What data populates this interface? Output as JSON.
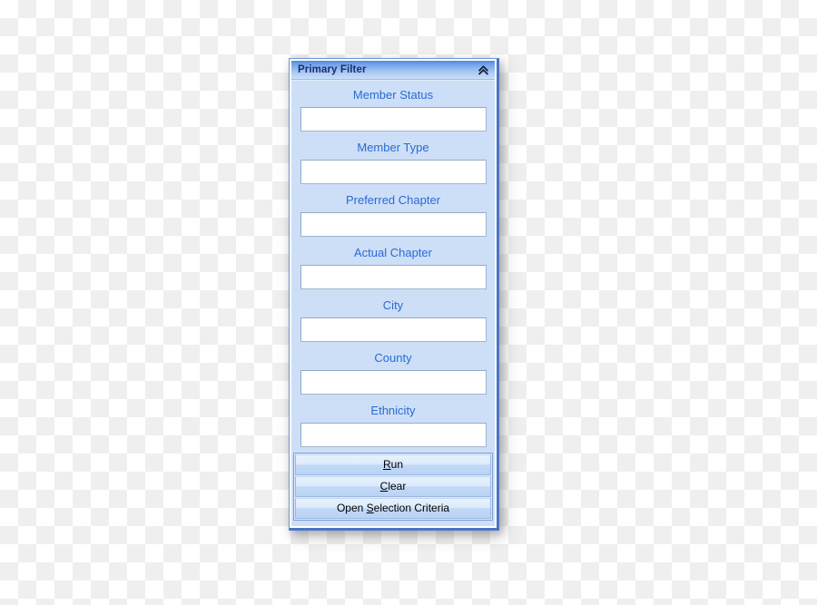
{
  "panel": {
    "title": "Primary Filter",
    "collapse_icon": "double-chevron-up-icon",
    "accent_color": "#4f86e0",
    "label_color": "#2a6ad4",
    "body_color": "#cddff7",
    "title_text_color": "#19306e"
  },
  "fields": [
    {
      "label": "Member Status",
      "value": "",
      "placeholder": ""
    },
    {
      "label": "Member Type",
      "value": "",
      "placeholder": ""
    },
    {
      "label": "Preferred Chapter",
      "value": "",
      "placeholder": ""
    },
    {
      "label": "Actual Chapter",
      "value": "",
      "placeholder": ""
    },
    {
      "label": "City",
      "value": "",
      "placeholder": ""
    },
    {
      "label": "County",
      "value": "",
      "placeholder": ""
    },
    {
      "label": "Ethnicity",
      "value": "",
      "placeholder": ""
    }
  ],
  "buttons": [
    {
      "pre": "",
      "accel": "R",
      "post": "un"
    },
    {
      "pre": "",
      "accel": "C",
      "post": "lear"
    },
    {
      "pre": "Open ",
      "accel": "S",
      "post": "election Criteria"
    }
  ]
}
